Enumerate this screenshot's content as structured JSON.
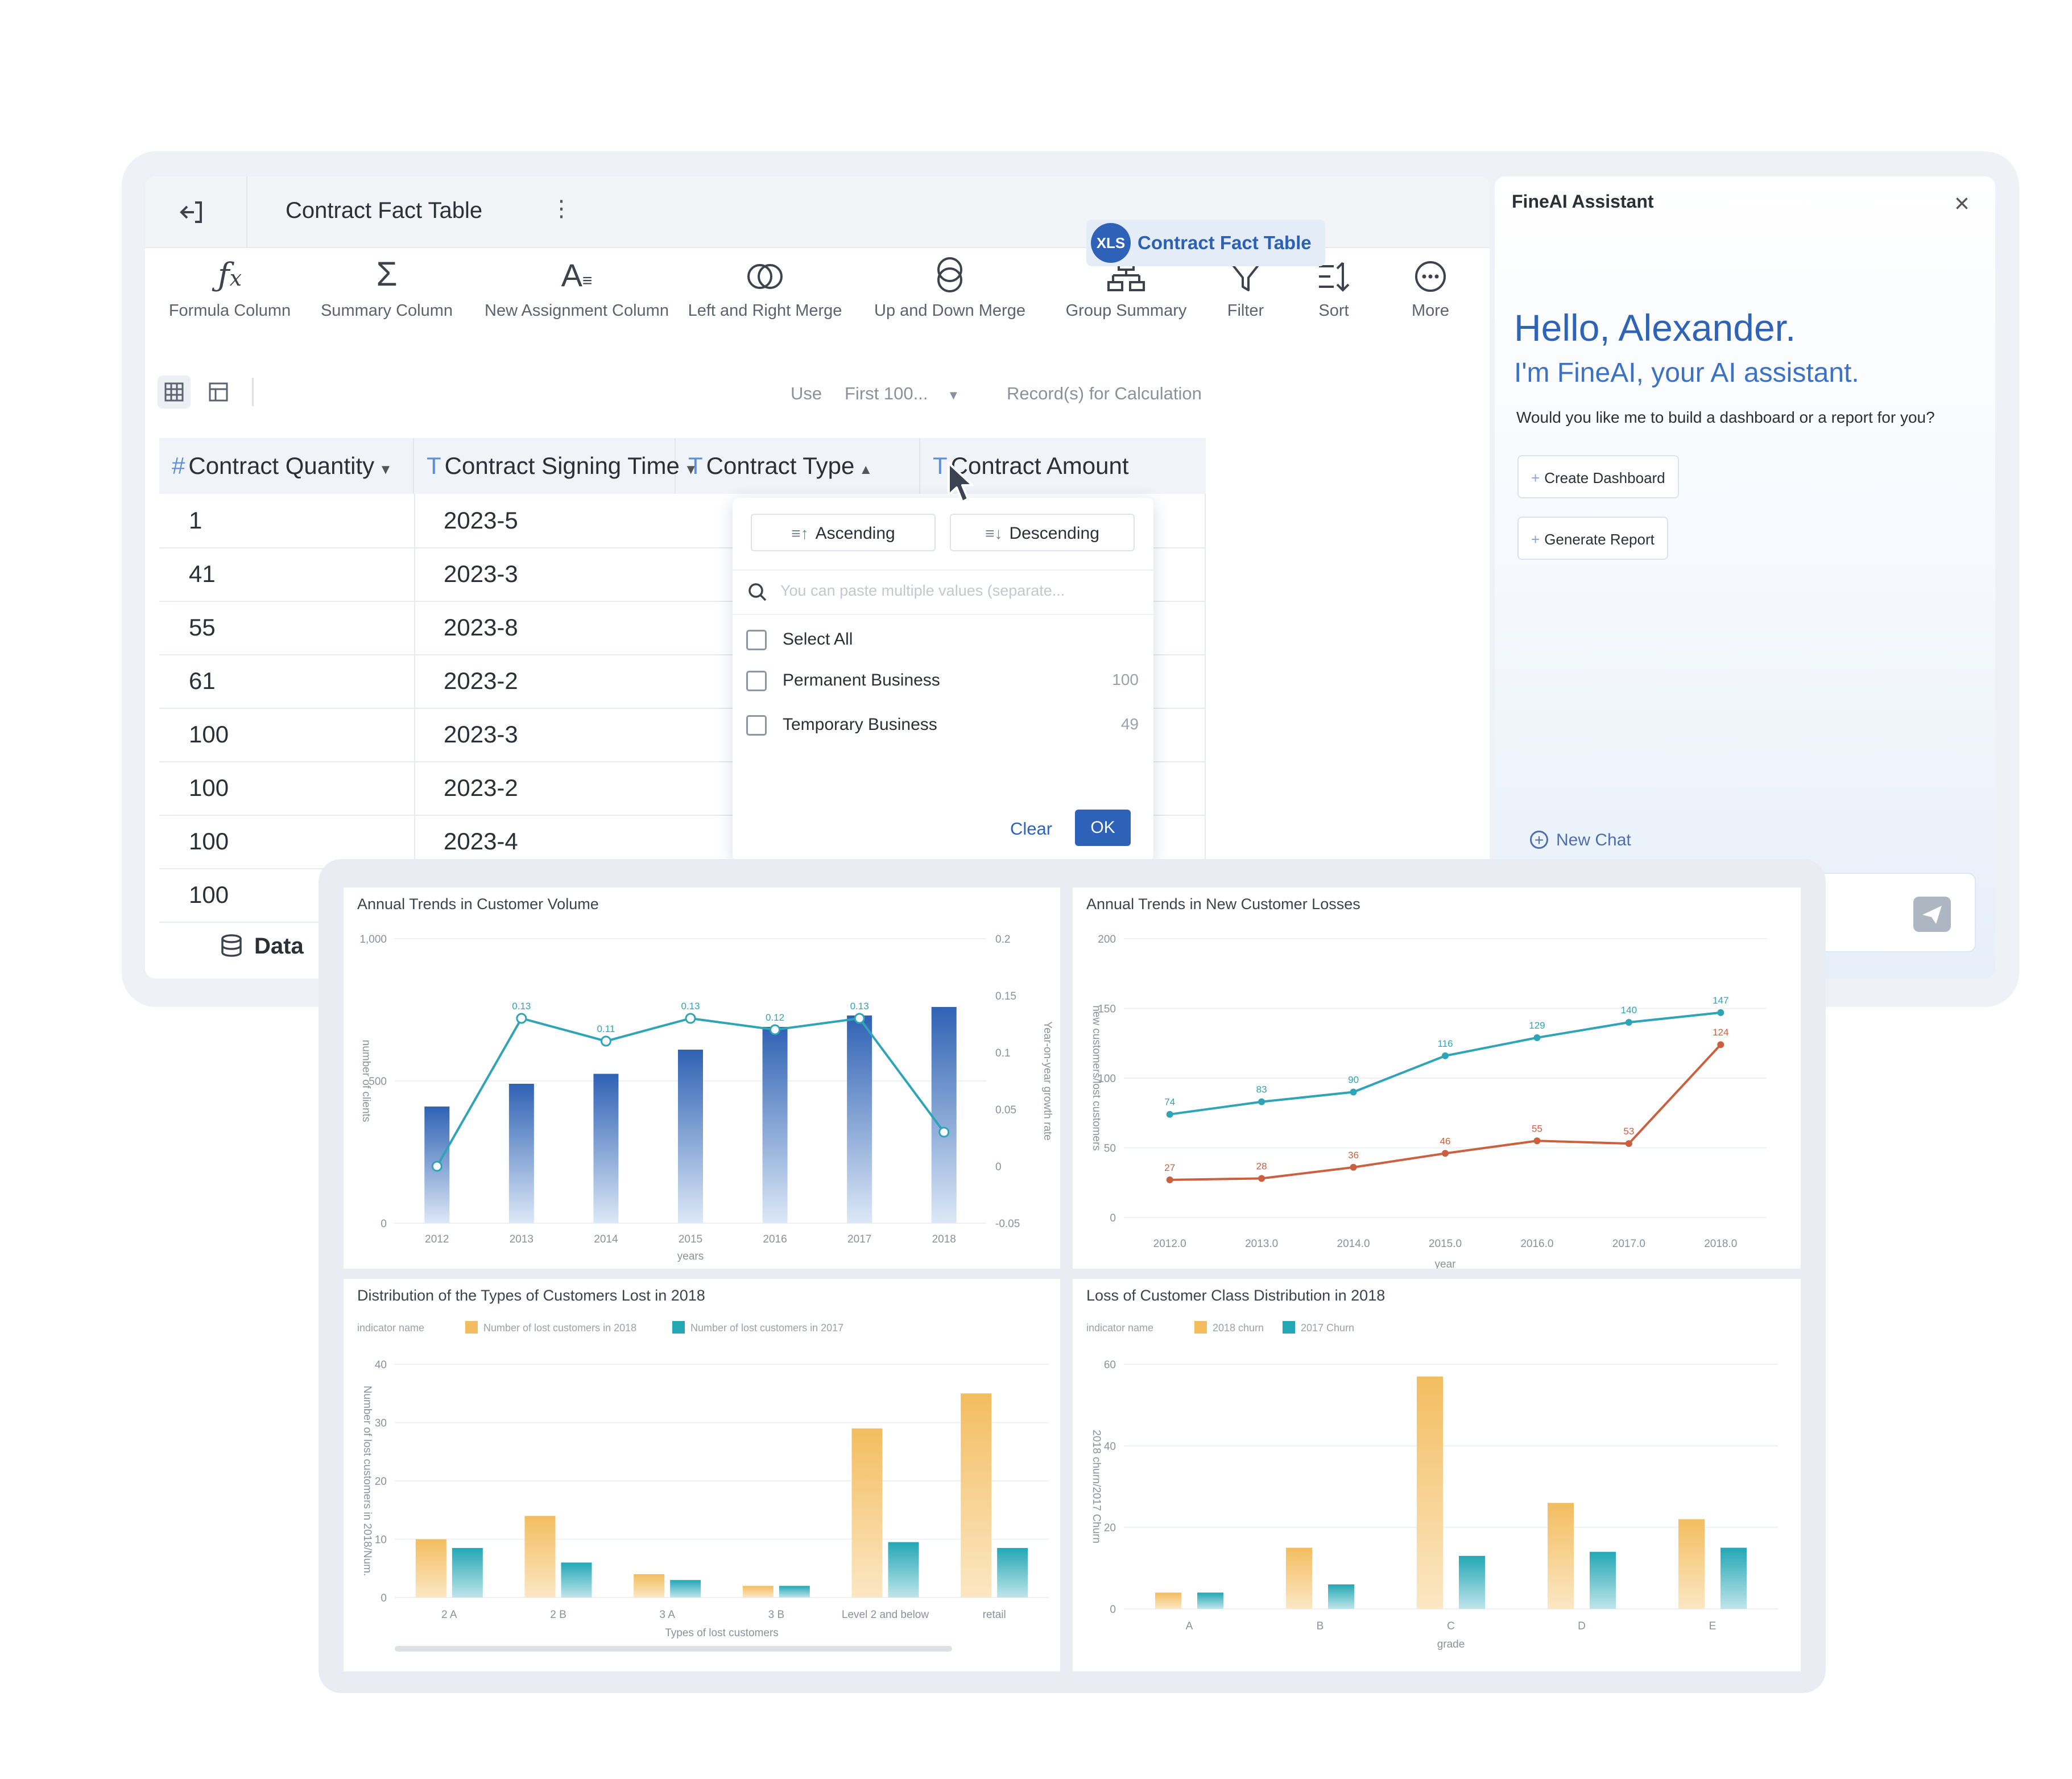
{
  "editor": {
    "title": "Contract Fact Table",
    "toolbar": [
      {
        "label": "Formula Column",
        "icon": "formula-icon"
      },
      {
        "label": "Summary Column",
        "icon": "sigma-icon"
      },
      {
        "label": "New Assignment Column",
        "icon": "assignment-icon"
      },
      {
        "label": "Left and Right Merge",
        "icon": "merge-lr-icon"
      },
      {
        "label": "Up and Down Merge",
        "icon": "merge-ud-icon"
      },
      {
        "label": "Group Summary",
        "icon": "group-icon"
      },
      {
        "label": "Filter",
        "icon": "filter-icon"
      },
      {
        "label": "Sort",
        "icon": "sort-icon"
      },
      {
        "label": "More",
        "icon": "more-icon"
      }
    ],
    "viewbar": {
      "use": "Use",
      "first": "First 100...",
      "records": "Record(s) for Calculation"
    },
    "columns": [
      {
        "type": "#",
        "label": "Contract Quantity"
      },
      {
        "type": "T",
        "label": "Contract Signing Time"
      },
      {
        "type": "T",
        "label": "Contract Type"
      },
      {
        "type": "T",
        "label": "Contract Amount"
      }
    ],
    "rows": [
      [
        "1",
        "2023-5"
      ],
      [
        "41",
        "2023-3"
      ],
      [
        "55",
        "2023-8"
      ],
      [
        "61",
        "2023-2"
      ],
      [
        "100",
        "2023-3"
      ],
      [
        "100",
        "2023-2"
      ],
      [
        "100",
        "2023-4"
      ],
      [
        "100",
        ""
      ]
    ],
    "data_tab": "Data",
    "dataset_chip": {
      "badge": "XLS",
      "name": "Contract Fact Table"
    },
    "filter": {
      "ascending": "Ascending",
      "descending": "Descending",
      "search_placeholder": "You can paste multiple values (separate...",
      "select_all": "Select All",
      "options": [
        {
          "label": "Permanent Business",
          "count": "100"
        },
        {
          "label": "Temporary Business",
          "count": "49"
        }
      ],
      "clear": "Clear",
      "ok": "OK"
    }
  },
  "assistant": {
    "title": "FineAI Assistant",
    "hello": "Hello, Alexander.",
    "intro": "I'm FineAI, your AI assistant.",
    "question": "Would you like me to build a dashboard or a report for you?",
    "actions": [
      "Create Dashboard",
      "Generate Report"
    ],
    "new_chat": "New Chat"
  },
  "chart_data": [
    {
      "type": "bar",
      "title": "Annual Trends in Customer Volume",
      "categories": [
        "2012",
        "2013",
        "2014",
        "2015",
        "2016",
        "2017",
        "2018"
      ],
      "xlabel": "years",
      "ylabel": "number of clients",
      "y2label": "Year-on-year growth rate",
      "yticks": [
        "0",
        "500",
        "1,000"
      ],
      "y2ticks": [
        "-0.05",
        "0",
        "0.05",
        "0.1",
        "0.15",
        "0.2"
      ],
      "ylim": [
        0,
        1000
      ],
      "y2lim": [
        -0.05,
        0.2
      ],
      "series": [
        {
          "values": [
            410,
            490,
            525,
            610,
            690,
            730,
            760
          ]
        }
      ],
      "line": {
        "values": [
          0.0,
          0.13,
          0.11,
          0.13,
          0.12,
          0.13,
          0.03
        ],
        "labels": [
          "",
          "0.13",
          "0.11",
          "0.13",
          "0.12",
          "0.13",
          ""
        ]
      }
    },
    {
      "type": "line",
      "title": "Annual Trends in New Customer Losses",
      "categories": [
        "2012.0",
        "2013.0",
        "2014.0",
        "2015.0",
        "2016.0",
        "2017.0",
        "2018.0"
      ],
      "xlabel": "year",
      "ylabel": "new customers/lost customers",
      "yticks": [
        "0",
        "50",
        "100",
        "150",
        "200"
      ],
      "ylim": [
        0,
        200
      ],
      "series": [
        {
          "values": [
            74,
            83,
            90,
            116,
            129,
            140,
            147
          ]
        },
        {
          "values": [
            27,
            28,
            36,
            46,
            55,
            53,
            124
          ]
        }
      ]
    },
    {
      "type": "bar",
      "title": "Distribution of the Types of Customers Lost in 2018",
      "legend_title": "indicator name",
      "categories": [
        "2 A",
        "2 B",
        "3 A",
        "3 B",
        "Level 2 and below",
        "retail"
      ],
      "xlabel": "Types of lost customers",
      "ylabel": "Number of lost customers in 2018/Num.",
      "yticks": [
        "0",
        "10",
        "20",
        "30",
        "40"
      ],
      "ylim": [
        0,
        40
      ],
      "series": [
        {
          "name": "Number of lost customers in 2018",
          "values": [
            10,
            14,
            4,
            2,
            29,
            35
          ]
        },
        {
          "name": "Number of lost customers in 2017",
          "values": [
            8.5,
            6,
            3,
            2,
            9.5,
            8.5
          ]
        }
      ]
    },
    {
      "type": "bar",
      "title": "Loss of Customer Class Distribution in 2018",
      "legend_title": "indicator name",
      "categories": [
        "A",
        "B",
        "C",
        "D",
        "E"
      ],
      "xlabel": "grade",
      "ylabel": "2018 churn/2017 Churn",
      "yticks": [
        "0",
        "20",
        "40",
        "60"
      ],
      "ylim": [
        0,
        60
      ],
      "series": [
        {
          "name": "2018 churn",
          "values": [
            4,
            15,
            57,
            26,
            22
          ]
        },
        {
          "name": "2017 Churn",
          "values": [
            4,
            6,
            13,
            14,
            15
          ]
        }
      ]
    }
  ],
  "colors": {
    "accent": "#2d62b8",
    "teal": "#2ea4b6",
    "orange": "#c9603f",
    "bar_blue": "#2f62b4",
    "bar_orange": "#f3bd5f",
    "bar_teal": "#23a7b5"
  }
}
